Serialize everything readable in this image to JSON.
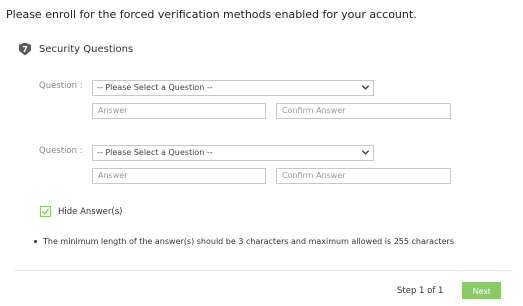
{
  "intro": "Please enroll for the forced verification methods enabled for your account.",
  "section": {
    "step_number": "7",
    "title": "Security Questions"
  },
  "questions": [
    {
      "label": "Question :",
      "select_value": "-- Please Select a Question --",
      "answer_placeholder": "Answer",
      "confirm_placeholder": "Confirm Answer"
    },
    {
      "label": "Question :",
      "select_value": "-- Please Select a Question --",
      "answer_placeholder": "Answer",
      "confirm_placeholder": "Confirm Answer"
    }
  ],
  "hide_answers": {
    "label": "Hide Answer(s)",
    "checked": true
  },
  "note": "The minimum length of the answer(s) should be 3 characters and maximum allowed is 255 characters",
  "footer": {
    "step_text": "Step 1 of 1",
    "next_label": "Next"
  },
  "colors": {
    "accent": "#8cc96b",
    "icon_bg": "#5a5a5a",
    "border": "#c8c8c8"
  },
  "icons": {
    "section": "shield-step-icon",
    "dropdown": "chevron-down-icon",
    "checkbox": "checkmark-icon"
  }
}
